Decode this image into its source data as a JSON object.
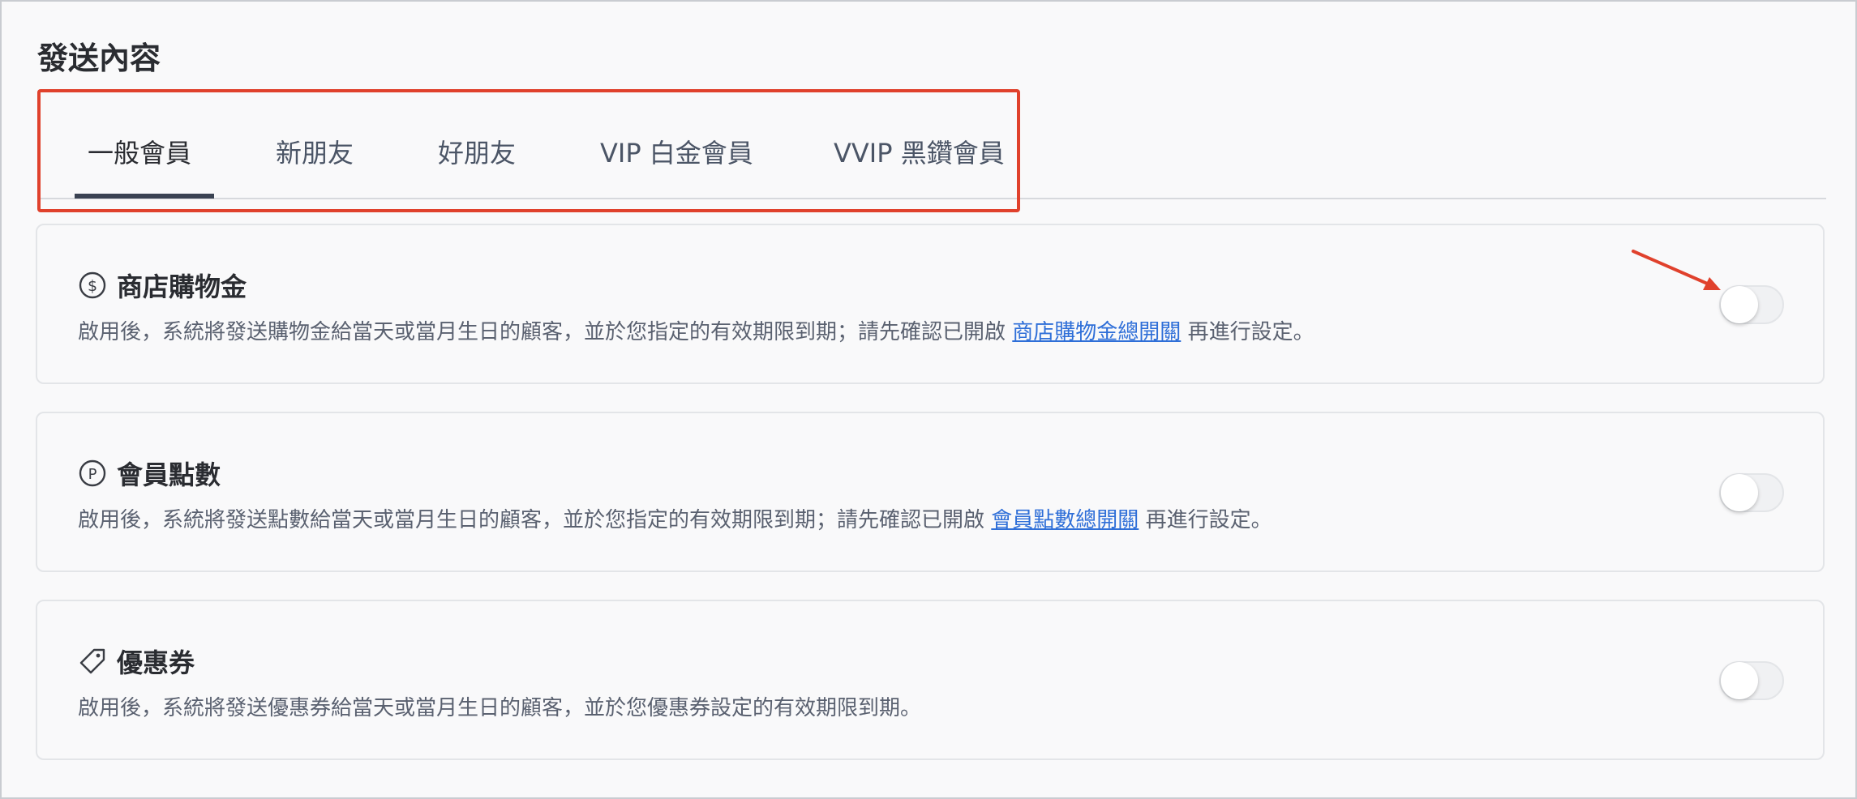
{
  "page": {
    "title": "發送內容"
  },
  "tabs": [
    {
      "label": "一般會員",
      "active": true
    },
    {
      "label": "新朋友",
      "active": false
    },
    {
      "label": "好朋友",
      "active": false
    },
    {
      "label": "VIP 白金會員",
      "active": false
    },
    {
      "label": "VVIP 黑鑽會員",
      "active": false
    }
  ],
  "cards": [
    {
      "icon": "dollar-circle-icon",
      "title": "商店購物金",
      "desc_before": "啟用後，系統將發送購物金給當天或當月生日的顧客，並於您指定的有效期限到期；請先確認已開啟",
      "link": "商店購物金總開關",
      "desc_after": "再進行設定。",
      "enabled": false
    },
    {
      "icon": "p-circle-icon",
      "title": "會員點數",
      "desc_before": "啟用後，系統將發送點數給當天或當月生日的顧客，並於您指定的有效期限到期；請先確認已開啟",
      "link": "會員點數總開關",
      "desc_after": "再進行設定。",
      "enabled": false
    },
    {
      "icon": "tag-icon",
      "title": "優惠券",
      "desc_before": "啟用後，系統將發送優惠券給當天或當月生日的顧客，並於您優惠券設定的有效期限到期。",
      "link": "",
      "desc_after": "",
      "enabled": false
    }
  ],
  "colors": {
    "annotation": "#e0412c",
    "link": "#2f6fd8",
    "active_tab_underline": "#3a4252"
  }
}
